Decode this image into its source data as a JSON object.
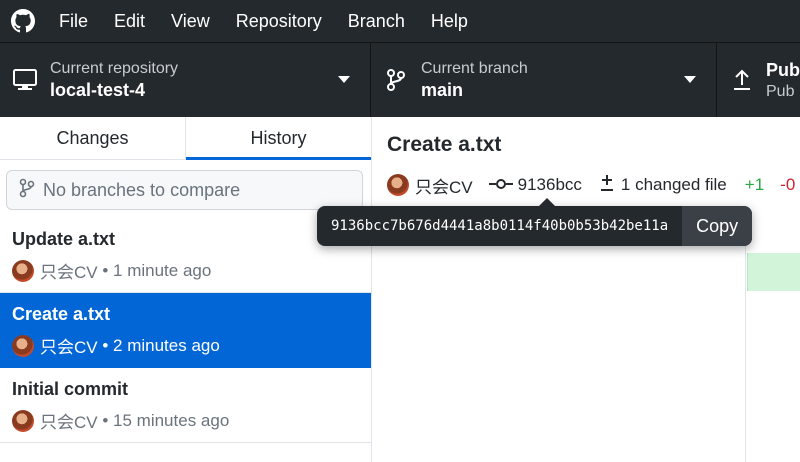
{
  "menu": [
    "File",
    "Edit",
    "View",
    "Repository",
    "Branch",
    "Help"
  ],
  "toolbar": {
    "repo_label": "Current repository",
    "repo_value": "local-test-4",
    "branch_label": "Current branch",
    "branch_value": "main",
    "push_label": "Pub",
    "push_sub": "Pub"
  },
  "tabs": [
    "Changes",
    "History"
  ],
  "compare_placeholder": "No branches to compare",
  "commits": [
    {
      "title": "Update a.txt",
      "author": "只会CV",
      "time": "• 1 minute ago"
    },
    {
      "title": "Create a.txt",
      "author": "只会CV",
      "time": "• 2 minutes ago"
    },
    {
      "title": "Initial commit",
      "author": "只会CV",
      "time": "• 15 minutes ago"
    }
  ],
  "detail": {
    "title": "Create a.txt",
    "author": "只会CV",
    "sha_short": "9136bcc",
    "changed_files": "1 changed file",
    "additions": "+1",
    "deletions": "-0"
  },
  "tooltip": {
    "sha_full": "9136bcc7b676d4441a8b0114f40b0b53b42be11a",
    "copy_label": "Copy"
  },
  "colors": {
    "toolbar_bg": "#24292e",
    "accent": "#0366d6",
    "additions": "#28a745",
    "deletions": "#cb2431"
  }
}
